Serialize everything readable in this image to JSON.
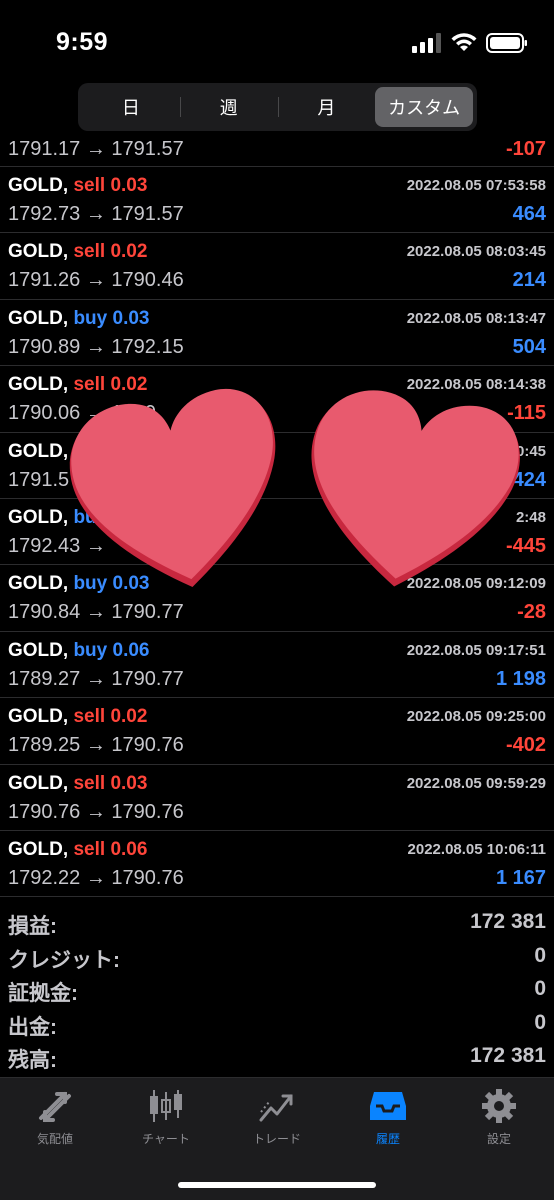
{
  "status_bar": {
    "time": "9:59"
  },
  "tabs_period": {
    "items": [
      "日",
      "週",
      "月",
      "カスタム"
    ],
    "active": 3
  },
  "deals": [
    {
      "partial": true,
      "symbol": "",
      "type": "",
      "volume": "",
      "date": "",
      "open": "1791.17",
      "close": "1791.57",
      "profit": "-107",
      "profit_sign": "neg"
    },
    {
      "symbol": "GOLD,",
      "type": "sell",
      "volume": "0.03",
      "date": "2022.08.05 07:53:58",
      "open": "1792.73",
      "close": "1791.57",
      "profit": "464",
      "profit_sign": "pos"
    },
    {
      "symbol": "GOLD,",
      "type": "sell",
      "volume": "0.02",
      "date": "2022.08.05 08:03:45",
      "open": "1791.26",
      "close": "1790.46",
      "profit": "214",
      "profit_sign": "pos"
    },
    {
      "symbol": "GOLD,",
      "type": "buy",
      "volume": "0.03",
      "date": "2022.08.05 08:13:47",
      "open": "1790.89",
      "close": "1792.15",
      "profit": "504",
      "profit_sign": "pos"
    },
    {
      "symbol": "GOLD,",
      "type": "sell",
      "volume": "0.02",
      "date": "2022.08.05 08:14:38",
      "open": "1790.06",
      "close": "1790",
      "profit": "-115",
      "profit_sign": "neg"
    },
    {
      "symbol": "GOLD,",
      "type": "s",
      "volume": "",
      "date": ":40:45",
      "open": "1791.5",
      "close": "",
      "profit": "424",
      "profit_sign": "pos"
    },
    {
      "symbol": "GOLD,",
      "type": "bu",
      "volume": "",
      "date": "2:48",
      "open": "1792.43",
      "close": "",
      "profit": "-445",
      "profit_sign": "neg"
    },
    {
      "symbol": "GOLD,",
      "type": "buy",
      "volume": "0.03",
      "date": "2022.08.05 09:12:09",
      "open": "1790.84",
      "close": "1790.77",
      "profit": "-28",
      "profit_sign": "neg"
    },
    {
      "symbol": "GOLD,",
      "type": "buy",
      "volume": "0.06",
      "date": "2022.08.05 09:17:51",
      "open": "1789.27",
      "close": "1790.77",
      "profit": "1 198",
      "profit_sign": "pos"
    },
    {
      "symbol": "GOLD,",
      "type": "sell",
      "volume": "0.02",
      "date": "2022.08.05 09:25:00",
      "open": "1789.25",
      "close": "1790.76",
      "profit": "-402",
      "profit_sign": "neg"
    },
    {
      "symbol": "GOLD,",
      "type": "sell",
      "volume": "0.03",
      "date": "2022.08.05 09:59:29",
      "open": "1790.76",
      "close": "1790.76",
      "profit": "",
      "profit_sign": "pos"
    },
    {
      "symbol": "GOLD,",
      "type": "sell",
      "volume": "0.06",
      "date": "2022.08.05 10:06:11",
      "open": "1792.22",
      "close": "1790.76",
      "profit": "1 167",
      "profit_sign": "pos"
    }
  ],
  "arrow": "→",
  "summary": [
    {
      "label": "損益:",
      "value": "172 381"
    },
    {
      "label": "クレジット:",
      "value": "0"
    },
    {
      "label": "証拠金:",
      "value": "0"
    },
    {
      "label": "出金:",
      "value": "0"
    },
    {
      "label": "残高:",
      "value": "172 381"
    }
  ],
  "tabbar": [
    {
      "label": "気配値",
      "icon": "quotes-icon"
    },
    {
      "label": "チャート",
      "icon": "chart-icon"
    },
    {
      "label": "トレード",
      "icon": "trade-icon"
    },
    {
      "label": "履歴",
      "icon": "history-icon"
    },
    {
      "label": "設定",
      "icon": "settings-icon"
    }
  ],
  "tabbar_active": 3,
  "colors": {
    "sell": "#ff453a",
    "buy": "#3a8cff",
    "active_tab": "#0a84ff",
    "heart": "#e85a6e"
  }
}
